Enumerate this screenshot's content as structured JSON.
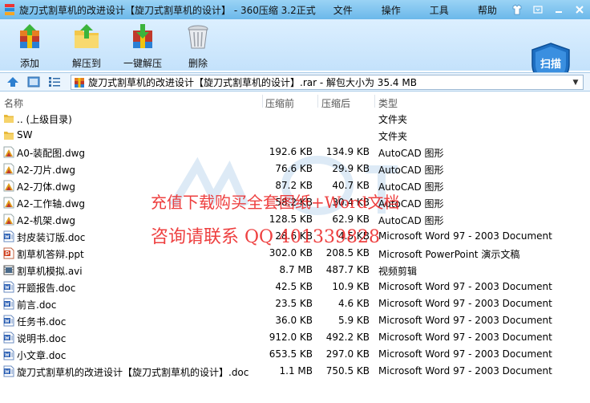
{
  "window": {
    "title": "旋刀式割草机的改进设计【旋刀式割草机的设计】 - 360压缩 3.2正式",
    "menu": [
      "文件",
      "操作",
      "工具",
      "帮助"
    ]
  },
  "toolbar": {
    "add": "添加",
    "extract_to": "解压到",
    "one_click_extract": "一键解压",
    "delete": "删除",
    "scan": "扫描"
  },
  "path": {
    "text": "旋刀式割草机的改进设计【旋刀式割草机的设计】.rar - 解包大小为 35.4 MB"
  },
  "columns": {
    "name": "名称",
    "packed": "压缩前",
    "unpacked": "压缩后",
    "type": "类型"
  },
  "rows": [
    {
      "name": ".. (上级目录)",
      "packed": "",
      "unpacked": "",
      "type": "文件夹",
      "icon": "folder-icon"
    },
    {
      "name": "SW",
      "packed": "",
      "unpacked": "",
      "type": "文件夹",
      "icon": "folder-icon"
    },
    {
      "name": "A0-装配图.dwg",
      "packed": "192.6 KB",
      "unpacked": "134.9 KB",
      "type": "AutoCAD 图形",
      "icon": "dwg-icon"
    },
    {
      "name": "A2-刀片.dwg",
      "packed": "76.6 KB",
      "unpacked": "29.9 KB",
      "type": "AutoCAD 图形",
      "icon": "dwg-icon"
    },
    {
      "name": "A2-刀体.dwg",
      "packed": "87.2 KB",
      "unpacked": "40.7 KB",
      "type": "AutoCAD 图形",
      "icon": "dwg-icon"
    },
    {
      "name": "A2-工作轴.dwg",
      "packed": "58.2 KB",
      "unpacked": "30.4 KB",
      "type": "AutoCAD 图形",
      "icon": "dwg-icon"
    },
    {
      "name": "A2-机架.dwg",
      "packed": "128.5 KB",
      "unpacked": "62.9 KB",
      "type": "AutoCAD 图形",
      "icon": "dwg-icon"
    },
    {
      "name": "封皮装订版.doc",
      "packed": "28.6 KB",
      "unpacked": "4.5 KB",
      "type": "Microsoft Word 97 - 2003 Document",
      "icon": "doc-icon"
    },
    {
      "name": "割草机答辩.ppt",
      "packed": "302.0 KB",
      "unpacked": "208.5 KB",
      "type": "Microsoft PowerPoint 演示文稿",
      "icon": "ppt-icon"
    },
    {
      "name": "割草机模拟.avi",
      "packed": "8.7 MB",
      "unpacked": "487.7 KB",
      "type": "视频剪辑",
      "icon": "avi-icon"
    },
    {
      "name": "开题报告.doc",
      "packed": "42.5 KB",
      "unpacked": "10.9 KB",
      "type": "Microsoft Word 97 - 2003 Document",
      "icon": "doc-icon"
    },
    {
      "name": "前言.doc",
      "packed": "23.5 KB",
      "unpacked": "4.6 KB",
      "type": "Microsoft Word 97 - 2003 Document",
      "icon": "doc-icon"
    },
    {
      "name": "任务书.doc",
      "packed": "36.0 KB",
      "unpacked": "5.9 KB",
      "type": "Microsoft Word 97 - 2003 Document",
      "icon": "doc-icon"
    },
    {
      "name": "说明书.doc",
      "packed": "912.0 KB",
      "unpacked": "492.2 KB",
      "type": "Microsoft Word 97 - 2003 Document",
      "icon": "doc-icon"
    },
    {
      "name": "小文章.doc",
      "packed": "653.5 KB",
      "unpacked": "297.0 KB",
      "type": "Microsoft Word 97 - 2003 Document",
      "icon": "doc-icon"
    },
    {
      "name": "旋刀式割草机的改进设计【旋刀式割草机的设计】.doc",
      "packed": "1.1 MB",
      "unpacked": "750.5 KB",
      "type": "Microsoft Word 97 - 2003 Document",
      "icon": "doc-icon"
    }
  ],
  "watermark": {
    "line1": "充值下载购买全套图纸+Word文档",
    "line2": "咨询请联系  QQ 401339828"
  },
  "colors": {
    "titlebar": "#7cc2ee",
    "toolbar": "#cfe7fc",
    "watermark": "#eb1e1e"
  }
}
